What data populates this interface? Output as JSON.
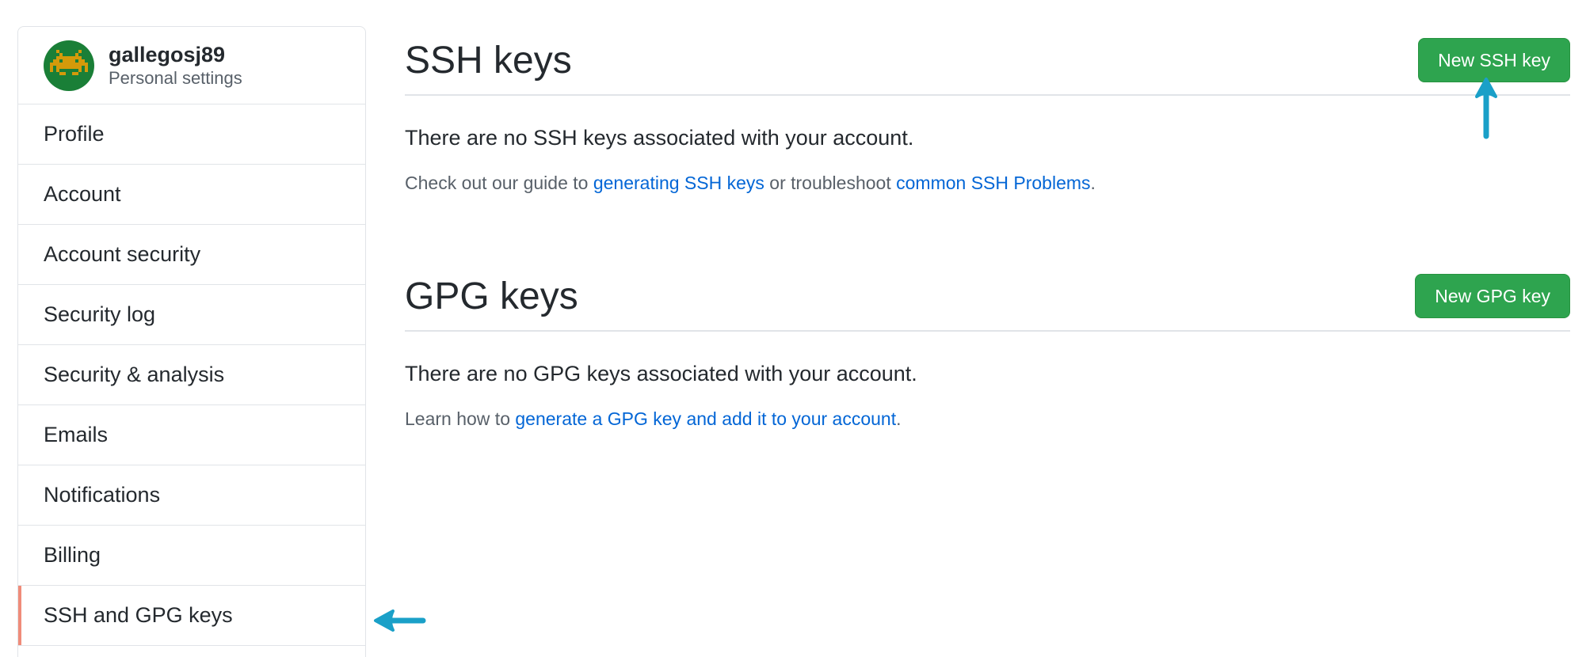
{
  "user": {
    "username": "gallegosj89",
    "subtitle": "Personal settings",
    "avatar_icon": "space-invader-avatar",
    "avatar_colors": {
      "background": "#1a7f37",
      "sprite": "#d49a0a"
    }
  },
  "sidebar": {
    "items": [
      {
        "label": "Profile"
      },
      {
        "label": "Account"
      },
      {
        "label": "Account security"
      },
      {
        "label": "Security log"
      },
      {
        "label": "Security & analysis"
      },
      {
        "label": "Emails"
      },
      {
        "label": "Notifications"
      },
      {
        "label": "Billing"
      },
      {
        "label": "SSH and GPG keys",
        "selected": true
      }
    ],
    "selected_accent": "#f08c7a"
  },
  "ssh": {
    "title": "SSH keys",
    "button": "New SSH key",
    "empty": "There are no SSH keys associated with your account.",
    "help_prefix": "Check out our guide to ",
    "help_link1": "generating SSH keys",
    "help_middle": " or troubleshoot ",
    "help_link2": "common SSH Problems",
    "help_suffix": "."
  },
  "gpg": {
    "title": "GPG keys",
    "button": "New GPG key",
    "empty": "There are no GPG keys associated with your account.",
    "help_prefix": "Learn how to ",
    "help_link": "generate a GPG key and add it to your account",
    "help_suffix": "."
  },
  "colors": {
    "primary_button": "#2ea44f",
    "link": "#0366d6",
    "annotation_arrow": "#1aa0c8"
  }
}
